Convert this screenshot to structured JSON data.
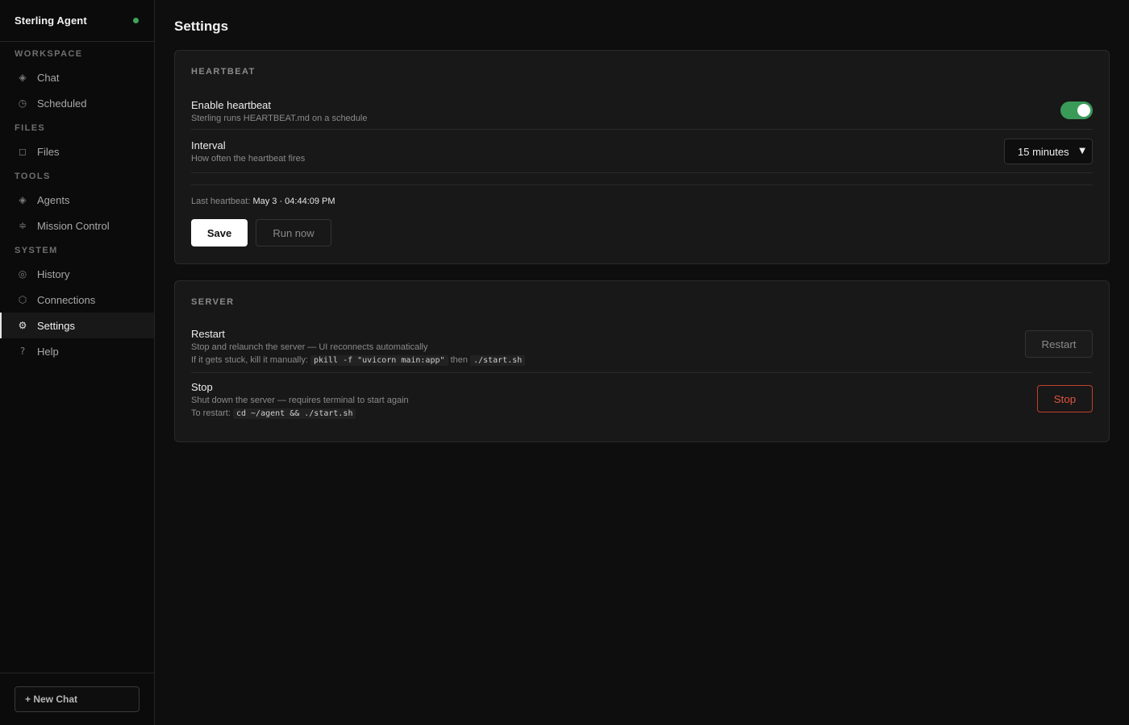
{
  "app": {
    "name": "Sterling Agent",
    "status_color": "#3da55d"
  },
  "sidebar": {
    "sections": [
      {
        "label": "WORKSPACE",
        "items": [
          {
            "label": "Chat",
            "icon": "diamond-icon",
            "glyph": "◈"
          },
          {
            "label": "Scheduled",
            "icon": "clock-icon",
            "glyph": "◷"
          }
        ]
      },
      {
        "label": "FILES",
        "items": [
          {
            "label": "Files",
            "icon": "square-icon",
            "glyph": "◻"
          }
        ]
      },
      {
        "label": "TOOLS",
        "items": [
          {
            "label": "Agents",
            "icon": "diamond-icon",
            "glyph": "◈"
          },
          {
            "label": "Mission Control",
            "icon": "mission-icon",
            "glyph": "≑"
          }
        ]
      },
      {
        "label": "SYSTEM",
        "items": [
          {
            "label": "History",
            "icon": "target-icon",
            "glyph": "◎"
          },
          {
            "label": "Connections",
            "icon": "hexagon-icon",
            "glyph": "⬡"
          },
          {
            "label": "Settings",
            "icon": "gear-icon",
            "glyph": "⚙",
            "active": true
          },
          {
            "label": "Help",
            "icon": "question-icon",
            "glyph": "?"
          }
        ]
      }
    ],
    "new_chat_label": "+ New Chat"
  },
  "page": {
    "title": "Settings"
  },
  "heartbeat": {
    "title": "HEARTBEAT",
    "enable": {
      "label": "Enable heartbeat",
      "desc": "Sterling runs HEARTBEAT.md on a schedule",
      "on": true
    },
    "interval": {
      "label": "Interval",
      "desc": "How often the heartbeat fires",
      "value": "15 minutes"
    },
    "last_label": "Last heartbeat:",
    "last_value": "May 3 · 04:44:09 PM",
    "save_label": "Save",
    "run_label": "Run now"
  },
  "server": {
    "title": "SERVER",
    "restart": {
      "label": "Restart",
      "desc": "Stop and relaunch the server — UI reconnects automatically",
      "hint_prefix": "If it gets stuck, kill it manually:",
      "hint_code1": "pkill -f \"uvicorn main:app\"",
      "hint_mid": "then",
      "hint_code2": "./start.sh",
      "button": "Restart"
    },
    "stop": {
      "label": "Stop",
      "desc": "Shut down the server — requires terminal to start again",
      "hint_prefix": "To restart:",
      "hint_code": "cd ~/agent && ./start.sh",
      "button": "Stop"
    }
  },
  "colors": {
    "accent_green": "#3a9a58",
    "danger": "#e0533f",
    "background": "#0e0e0e",
    "card": "#181818"
  }
}
